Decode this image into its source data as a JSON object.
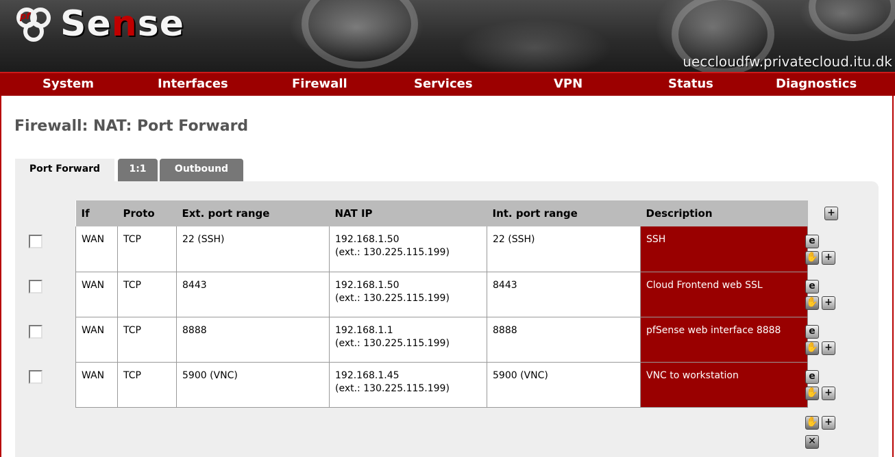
{
  "header": {
    "logo_prefix": "pf",
    "logo_text_a": "Se",
    "logo_text_b": "n",
    "logo_text_c": "se",
    "hostname": "ueccloudfw.privatecloud.itu.dk"
  },
  "nav": [
    "System",
    "Interfaces",
    "Firewall",
    "Services",
    "VPN",
    "Status",
    "Diagnostics"
  ],
  "page_title": "Firewall: NAT: Port Forward",
  "tabs": [
    {
      "label": "Port Forward",
      "active": true
    },
    {
      "label": "1:1",
      "active": false
    },
    {
      "label": "Outbound",
      "active": false
    }
  ],
  "table": {
    "columns": [
      "If",
      "Proto",
      "Ext. port range",
      "NAT IP",
      "Int. port range",
      "Description"
    ],
    "rows": [
      {
        "if": "WAN",
        "proto": "TCP",
        "ext": "22 (SSH)",
        "nat_ip": "192.168.1.50",
        "nat_ext": "(ext.: 130.225.115.199)",
        "int": "22 (SSH)",
        "desc": "SSH"
      },
      {
        "if": "WAN",
        "proto": "TCP",
        "ext": "8443",
        "nat_ip": "192.168.1.50",
        "nat_ext": "(ext.: 130.225.115.199)",
        "int": "8443",
        "desc": "Cloud Frontend web SSL"
      },
      {
        "if": "WAN",
        "proto": "TCP",
        "ext": "8888",
        "nat_ip": "192.168.1.1",
        "nat_ext": "(ext.: 130.225.115.199)",
        "int": "8888",
        "desc": "pfSense web interface 8888"
      },
      {
        "if": "WAN",
        "proto": "TCP",
        "ext": "5900 (VNC)",
        "nat_ip": "192.168.1.45",
        "nat_ext": "(ext.: 130.225.115.199)",
        "int": "5900 (VNC)",
        "desc": "VNC to workstation"
      }
    ]
  },
  "icons": {
    "edit": "e",
    "add": "+",
    "move": "✋",
    "delete": "✕"
  }
}
